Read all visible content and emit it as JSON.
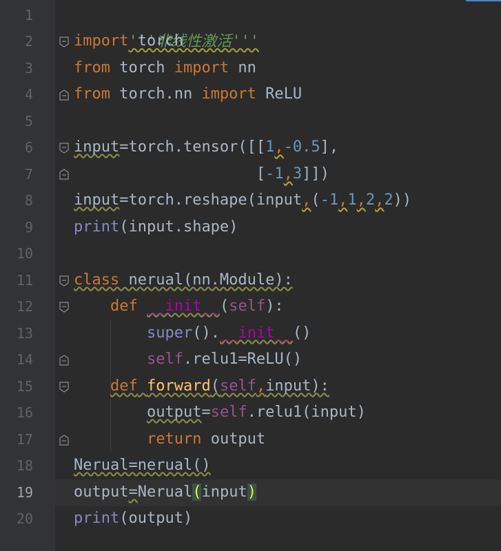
{
  "gutter": {
    "line_numbers": [
      "1",
      "2",
      "3",
      "4",
      "5",
      "6",
      "7",
      "8",
      "9",
      "10",
      "11",
      "12",
      "13",
      "14",
      "15",
      "16",
      "17",
      "18",
      "19",
      "20"
    ],
    "current_line": "19"
  },
  "code": {
    "l1": {
      "docstring": "'''非线性激活'''"
    },
    "l2": {
      "kw": "import",
      "mod": " torch"
    },
    "l3": {
      "kw_from": "from",
      "mod": " torch ",
      "kw_import": "import",
      "name": " nn"
    },
    "l4": {
      "kw_from": "from",
      "mod": " torch.nn ",
      "kw_import": "import",
      "name": " ReLU"
    },
    "l6": {
      "var": "input",
      "rest1": "=torch.tensor([[",
      "n1": "1",
      "c1": ",",
      "n2": "-0.5",
      "rest2": "],"
    },
    "l7": {
      "pad": "                    [",
      "n1": "-1",
      "c1": ",",
      "n2": "3",
      "rest": "]])"
    },
    "l8": {
      "var": "input",
      "rest1": "=torch.reshape(input",
      "c1": ",",
      "p": "(",
      "n1": "-1",
      "c2": ",",
      "n2": "1",
      "c3": ",",
      "n3": "2",
      "c4": ",",
      "n4": "2",
      "rest2": "))"
    },
    "l9": {
      "builtin": "print",
      "rest": "(input.shape)"
    },
    "l11": {
      "kw": "class",
      "name": " nerual(nn.Module):"
    },
    "l12": {
      "indent": "    ",
      "kw": "def",
      "sp": " ",
      "magic": "__init__",
      "p1": "(",
      "self": "self",
      "p2": "):"
    },
    "l13": {
      "indent": "        ",
      "builtin": "super",
      "p1": "().",
      "magic": "__init__",
      "p2": "()"
    },
    "l14": {
      "indent": "        ",
      "self": "self",
      "rest": ".relu1=ReLU()"
    },
    "l15": {
      "indent": "    ",
      "kw": "def",
      "sp": " ",
      "fn": "forward",
      "p1": "(",
      "self": "self",
      "c": ",",
      "rest": "input):"
    },
    "l16": {
      "indent": "        ",
      "var": "output",
      "eq": "=",
      "self": "self",
      "rest": ".relu1(input)"
    },
    "l17": {
      "indent": "        ",
      "kw": "return",
      "rest": " output"
    },
    "l18": {
      "text": "Nerual=nerual()"
    },
    "l19": {
      "pre": "output",
      "eq": "=",
      "call": "Nerual",
      "lp": "(",
      "arg": "input",
      "rp": ")"
    },
    "l20": {
      "builtin": "print",
      "rest": "(output)"
    }
  },
  "colors": {
    "background": "#2b2b2b",
    "keyword": "#cc7832",
    "number": "#6897bb",
    "builtin": "#8888c6",
    "self": "#94558d",
    "magic": "#b200b2",
    "function_def": "#ffc66d",
    "docstring": "#629755"
  }
}
